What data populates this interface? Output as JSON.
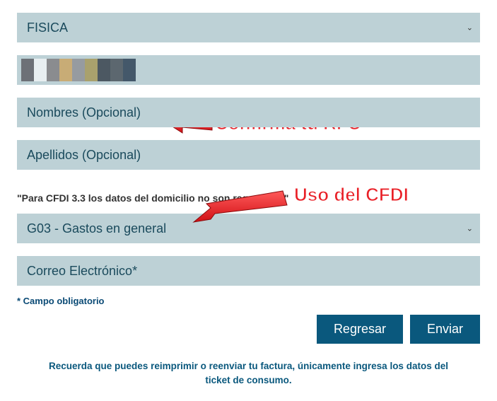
{
  "persona_select": {
    "value": "FISICA"
  },
  "rfc": {
    "value": ""
  },
  "nombres": {
    "placeholder": "Nombres (Opcional)"
  },
  "apellidos": {
    "placeholder": "Apellidos (Opcional)"
  },
  "cfdi_note": "\"Para CFDI 3.3 los datos del domicilio no son requeridos\"",
  "uso_cfdi": {
    "value": "G03 - Gastos en general"
  },
  "correo": {
    "placeholder": "Correo Electrónico*"
  },
  "required_note": "* Campo obligatorio",
  "buttons": {
    "back": "Regresar",
    "send": "Enviar"
  },
  "footer": "Recuerda que puedes reimprimir o reenviar tu factura, únicamente ingresa los datos del ticket de consumo.",
  "annotations": {
    "confirm_rfc": "Confirma tu RFC",
    "uso_cfdi_label": "Uso del CFDI"
  }
}
